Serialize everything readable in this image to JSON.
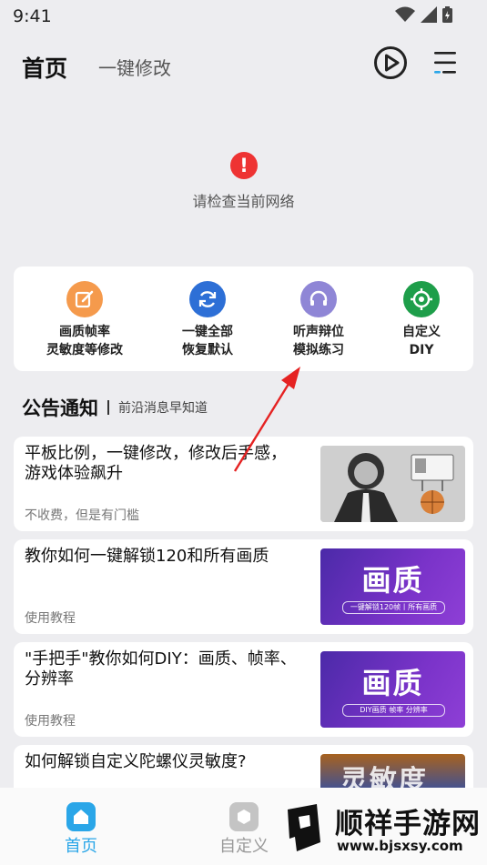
{
  "status": {
    "time": "9:41"
  },
  "header": {
    "title": "首页",
    "subtitle": "一键修改"
  },
  "network": {
    "icon_text": "!",
    "message": "请检查当前网络"
  },
  "quick_actions": [
    {
      "line1": "画质帧率",
      "line2": "灵敏度等修改",
      "icon": "edit-icon",
      "color": "#f59a4c"
    },
    {
      "line1": "一键全部",
      "line2": "恢复默认",
      "icon": "refresh-icon",
      "color": "#2d6fd6"
    },
    {
      "line1": "听声辩位",
      "line2": "模拟练习",
      "icon": "headset-icon",
      "color": "#8f86d6"
    },
    {
      "line1": "自定义",
      "line2": "DIY",
      "icon": "crosshair-icon",
      "color": "#1e9e4a"
    }
  ],
  "notice": {
    "heading": "公告通知",
    "subheading": "前沿消息早知道"
  },
  "articles": [
    {
      "title": "平板比例，一键修改，修改后手感，游戏体验飙升",
      "tag": "不收费，但是有门槛",
      "thumb_big": "",
      "thumb_small": ""
    },
    {
      "title": "教你如何一键解锁120和所有画质",
      "tag": "使用教程",
      "thumb_big": "画质",
      "thumb_small": "一键解锁120帧丨所有画质"
    },
    {
      "title": "\"手把手\"教你如何DIY：画质、帧率、分辨率",
      "tag": "使用教程",
      "thumb_big": "画质",
      "thumb_small": "DIY画质  帧率  分辨率"
    },
    {
      "title": "如何解锁自定义陀螺仪灵敏度?",
      "tag": "",
      "thumb_big": "灵敏度",
      "thumb_small": ""
    }
  ],
  "bottom_nav": [
    {
      "label": "首页",
      "active": true
    },
    {
      "label": "自定义",
      "active": false
    }
  ],
  "watermark": {
    "name": "顺祥手游网",
    "url": "www.bjsxsy.com"
  },
  "colors": {
    "accent": "#2aa6e8",
    "error": "#ee3333",
    "arrow": "#e52222"
  }
}
